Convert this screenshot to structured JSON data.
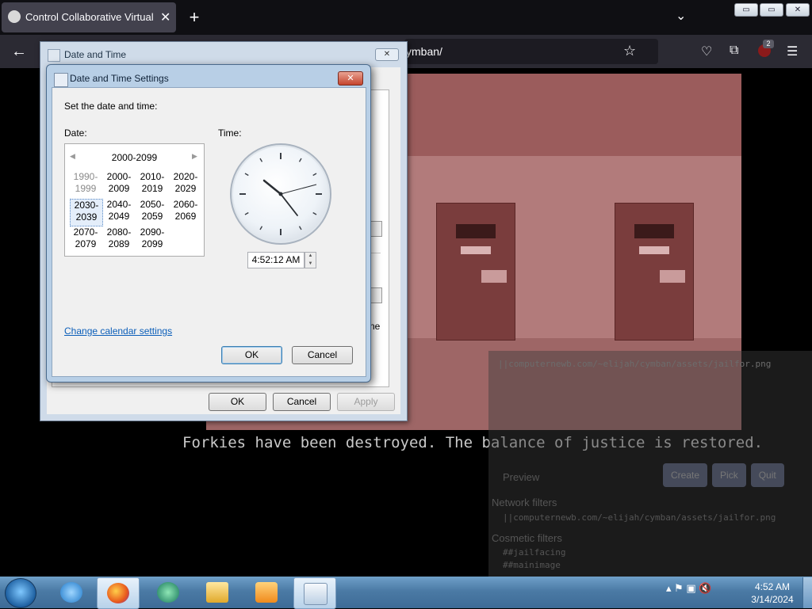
{
  "browser": {
    "tab_title": "Control Collaborative Virtual M",
    "tab_close": "✕",
    "new_tab": "+",
    "url_fragment": "ymban/",
    "tablist_glyph": "⌄",
    "extension_badge": "2",
    "window_buttons": {
      "minimize": "▭",
      "restore": "▭",
      "close": "✕"
    }
  },
  "page": {
    "message": "Forkies have been destroyed. The balance of justice is restored.",
    "panel": {
      "url": "||computernewb.com/~elijah/cymban/assets/jailfor.png",
      "preview": "Preview",
      "buttons": [
        "Create",
        "Pick",
        "Quit"
      ],
      "network_filters_heading": "Network filters",
      "network_filter": "||computernewb.com/~elijah/cymban/assets/jailfor.png",
      "cosmetic_filters_heading": "Cosmetic filters",
      "cosmetic_filter_1": "##jailfacing",
      "cosmetic_filter_2": "##mainimage"
    },
    "partial_text": "ne"
  },
  "date_time_window": {
    "title": "Date and Time",
    "close": "✕",
    "ok": "OK",
    "cancel": "Cancel",
    "apply": "Apply"
  },
  "settings_dialog": {
    "title": "Date and Time Settings",
    "close": "✕",
    "instruction": "Set the date and time:",
    "date_label": "Date:",
    "time_label": "Time:",
    "calendar": {
      "header": "2000-2099",
      "prev": "◀",
      "next": "▶",
      "decades": [
        {
          "l1": "1990-",
          "l2": "1999"
        },
        {
          "l1": "2000-",
          "l2": "2009"
        },
        {
          "l1": "2010-",
          "l2": "2019"
        },
        {
          "l1": "2020-",
          "l2": "2029"
        },
        {
          "l1": "2030-",
          "l2": "2039"
        },
        {
          "l1": "2040-",
          "l2": "2049"
        },
        {
          "l1": "2050-",
          "l2": "2059"
        },
        {
          "l1": "2060-",
          "l2": "2069"
        },
        {
          "l1": "2070-",
          "l2": "2079"
        },
        {
          "l1": "2080-",
          "l2": "2089"
        },
        {
          "l1": "2090-",
          "l2": "2099"
        }
      ]
    },
    "time_value": "4:52:12 AM",
    "spin_up": "▲",
    "spin_down": "▼",
    "change_calendar_link": "Change calendar settings",
    "ok": "OK",
    "cancel": "Cancel"
  },
  "taskbar": {
    "clock_time": "4:52 AM",
    "clock_date": "3/14/2024",
    "tray_glyphs": "▴ ⚑ ▣ 🔇"
  },
  "colors": {
    "accent_link": "#0b5eb9",
    "game_wall": "#b27b7b",
    "door": "#7a3d3d"
  }
}
